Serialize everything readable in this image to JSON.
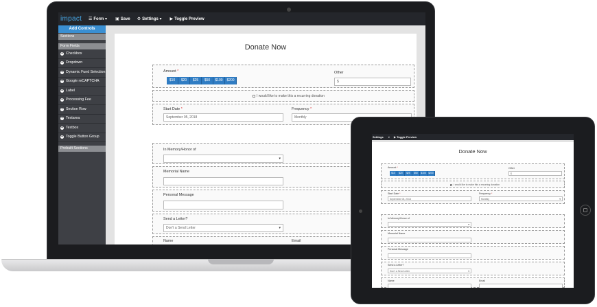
{
  "app": {
    "logo": "impact",
    "menu": {
      "form": "Form",
      "save": "Save",
      "settings": "Settings",
      "toggle_preview": "Toggle Preview"
    }
  },
  "sidebar": {
    "add_controls": "Add Controls",
    "sections_label": "Sections",
    "form_fields_label": "Form Fields",
    "items": [
      "Checkbox",
      "Dropdown",
      "Dynamic Fund Selection",
      "Google reCAPTCHA",
      "Label",
      "Processing Fee",
      "Section Row",
      "Textarea",
      "Textbox",
      "Toggle Button Group"
    ],
    "prebuilt_label": "Prebuilt Sections"
  },
  "form": {
    "title": "Donate Now",
    "amount_label": "Amount",
    "amount_buttons": [
      "$10",
      "$20",
      "$25",
      "$50",
      "$100",
      "$200"
    ],
    "other_label": "Other",
    "other_value": "$",
    "recurring_label": "I would like to make this a recurring donation",
    "start_date_label": "Start Date",
    "start_date_value": "September 05, 2018",
    "frequency_label": "Frequency",
    "frequency_value": "Monthly",
    "memory_label": "In Memory/Honor of",
    "memorial_name_label": "Memorial Name",
    "personal_message_label": "Personal Message",
    "send_letter_label": "Send a Letter?",
    "send_letter_value": "Don't a Send Letter",
    "name_label": "Name",
    "email_label": "Email"
  },
  "tablet": {
    "settings": "Settings",
    "toggle_preview": "Toggle Preview"
  },
  "colors": {
    "accent": "#2f7cc3",
    "header": "#24262b",
    "sidebar": "#3e4045"
  }
}
